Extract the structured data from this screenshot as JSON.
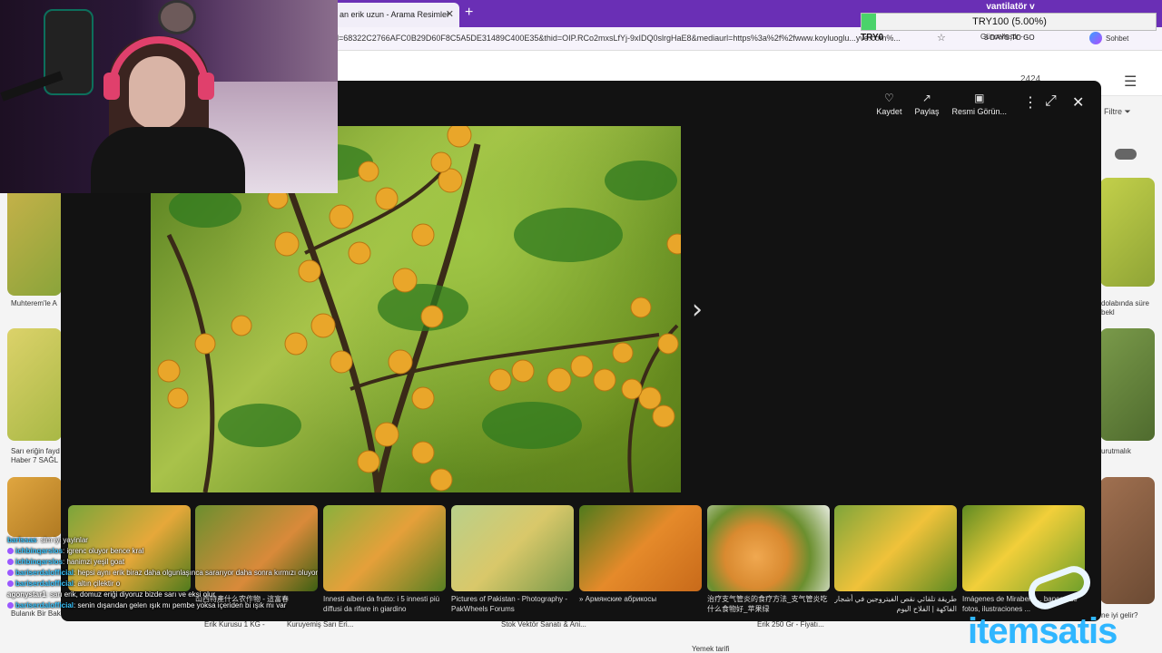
{
  "browser": {
    "tab_title": "an erik uzun - Arama Resimler",
    "tab_close": "✕",
    "new_tab": "+",
    "url": "d=68322C2766AFC0B29D60F8C5A5DE31489C400E35&thid=OIP.RCo2mxsLfYj-9xIDQ0slrgHaE8&mediaurl=https%3a%2f%2fwww.koyluoglu...yve.com%...",
    "update_label": "Güncelleştir",
    "profile_name": "Sohbet"
  },
  "bing": {
    "result_count": "2424",
    "filter_label": "Filtre",
    "bg_captions": [
      "Muhterem'le A",
      "Sarı eriğin fayd Haber 7 SAĞL",
      "dolabında süre bekl",
      "urutmalık",
      "Bulanık Bir Bak",
      "Erik Kurusu 1 KG -",
      "Kuruyemiş Sarı Eri...",
      "Stok Vektör Sanatı & Ani...",
      "Erik 250 Gr - Fiyatı...",
      "Yemek tarifi",
      "ne iyi gelir?"
    ]
  },
  "modal": {
    "actions": [
      {
        "icon": "♡",
        "label": "Kaydet"
      },
      {
        "icon": "↗",
        "label": "Paylaş"
      },
      {
        "icon": "▣",
        "label": "Resmi Görün..."
      }
    ],
    "more_icon": "⋮",
    "expand_icon": "⤢",
    "close_icon": "✕",
    "next_icon": "›",
    "zoom_icon": "⛶",
    "related": [
      {
        "caption": ""
      },
      {
        "caption": "山西特產什么农作物 - 這富春"
      },
      {
        "caption": "Innesti alberi da frutto: i 5 innesti più diffusi da rifare in giardino"
      },
      {
        "caption": "Pictures of Pakistan - Photography - PakWheels Forums"
      },
      {
        "caption": "» Армянские абрикосы"
      },
      {
        "caption": "治疗支气管炎的食疗方法_支气管炎吃什么食物好_苹果绿"
      },
      {
        "caption": "طريقة تلقائي نقص الفيتروجين في أشجار الفاكهة | الفلاح اليوم"
      },
      {
        "caption": "Imágenes de Mirabelle... bancos de fotos, ilustraciones ..."
      }
    ]
  },
  "donation": {
    "title": "vantilatör v",
    "progress_text": "TRY100 (5.00%)",
    "progress_fraction": 0.05,
    "current": "TRY0",
    "days_left": "3 DAYS TO GO"
  },
  "chat": [
    {
      "user": "barissas",
      "text": "slm iyi yayinlar",
      "color": "#39c5ff",
      "badge": ""
    },
    {
      "user": "ichbinqarslos",
      "text": "igrenc oluyor bence kral",
      "color": "#39c5ff",
      "badge": "#9b59ff"
    },
    {
      "user": "ichbinqarslos",
      "text": "hanimzi yeşil goat",
      "color": "#39c5ff",
      "badge": "#9b59ff"
    },
    {
      "user": "bariserdalofficial",
      "text": "hepsi aynı erik biraz daha olgunlaşınca sararıyor daha sonra kırmızı oluyor",
      "color": "#39c5ff",
      "badge": "#9b59ff"
    },
    {
      "user": "bariserdalofficial",
      "text": "altın çilektir o",
      "color": "#39c5ff",
      "badge": "#9b59ff"
    },
    {
      "user": "agonystar1",
      "text": "sarı erik, domuz eriği diyoruz bizde sarı ve ekşi olur",
      "color": "#ffffff",
      "badge": ""
    },
    {
      "user": "bariserdalofficial",
      "text": "senin dışarıdan gelen ışık mı pembe yoksa içeriden bi ışık mı var",
      "color": "#39c5ff",
      "badge": "#9b59ff"
    }
  ],
  "logo": {
    "text": "itemsatis"
  },
  "colors": {
    "browser_purple": "#6a2fb5",
    "modal_bg": "#121212",
    "progress_green": "#4ad36a",
    "chat_user": "#39c5ff",
    "logo_blue": "#2fb6ff"
  }
}
